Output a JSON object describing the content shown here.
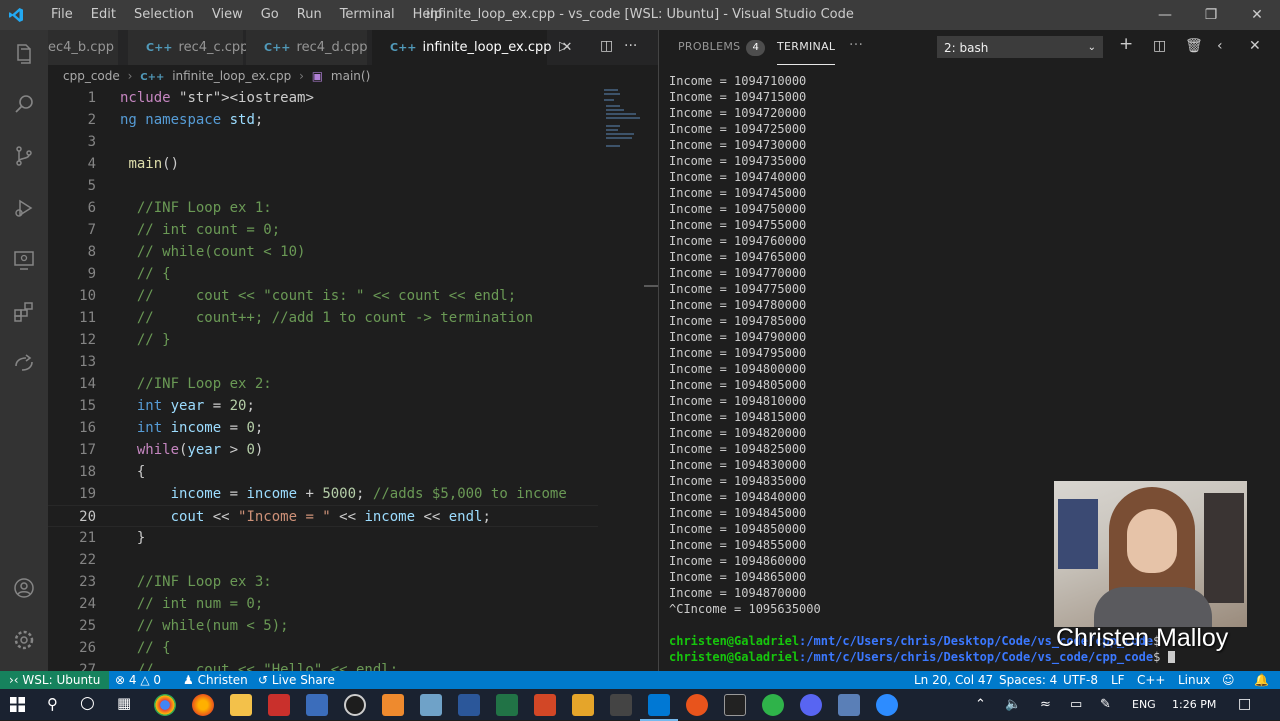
{
  "window": {
    "title": "infinite_loop_ex.cpp - vs_code [WSL: Ubuntu] - Visual Studio Code",
    "menu": [
      "File",
      "Edit",
      "Selection",
      "View",
      "Go",
      "Run",
      "Terminal",
      "Help"
    ]
  },
  "editor": {
    "tabs": [
      {
        "label": "ec4_b.cpp",
        "icon": "cpp-file-icon"
      },
      {
        "label": "rec4_c.cpp",
        "icon": "cpp-file-icon"
      },
      {
        "label": "rec4_d.cpp",
        "icon": "cpp-file-icon"
      },
      {
        "label": "infinite_loop_ex.cpp",
        "icon": "cpp-file-icon",
        "active": true
      }
    ],
    "breadcrumb": [
      "cpp_code",
      "infinite_loop_ex.cpp",
      "main()"
    ],
    "lines": [
      {
        "n": "1",
        "text": "nclude <iostream>"
      },
      {
        "n": "2",
        "text": "ng namespace std;"
      },
      {
        "n": "3",
        "text": ""
      },
      {
        "n": "4",
        "text": " main()"
      },
      {
        "n": "5",
        "text": ""
      },
      {
        "n": "6",
        "text": "  //INF Loop ex 1:"
      },
      {
        "n": "7",
        "text": "  // int count = 0;"
      },
      {
        "n": "8",
        "text": "  // while(count < 10)"
      },
      {
        "n": "9",
        "text": "  // {"
      },
      {
        "n": "10",
        "text": "  //     cout << \"count is: \" << count << endl;"
      },
      {
        "n": "11",
        "text": "  //     count++; //add 1 to count -> termination"
      },
      {
        "n": "12",
        "text": "  // }"
      },
      {
        "n": "13",
        "text": ""
      },
      {
        "n": "14",
        "text": "  //INF Loop ex 2:"
      },
      {
        "n": "15",
        "text": "  int year = 20;"
      },
      {
        "n": "16",
        "text": "  int income = 0;"
      },
      {
        "n": "17",
        "text": "  while(year > 0)"
      },
      {
        "n": "18",
        "text": "  {"
      },
      {
        "n": "19",
        "text": "      income = income + 5000; //adds $5,000 to income"
      },
      {
        "n": "20",
        "text": "      cout << \"Income = \" << income << endl;"
      },
      {
        "n": "21",
        "text": "  }"
      },
      {
        "n": "22",
        "text": ""
      },
      {
        "n": "23",
        "text": "  //INF Loop ex 3:"
      },
      {
        "n": "24",
        "text": "  // int num = 0;"
      },
      {
        "n": "25",
        "text": "  // while(num < 5);"
      },
      {
        "n": "26",
        "text": "  // {"
      },
      {
        "n": "27",
        "text": "  //     cout << \"Hello\" << endl;"
      }
    ]
  },
  "panel": {
    "problems_label": "PROBLEMS",
    "problems_count": "4",
    "terminal_label": "TERMINAL",
    "terminal_select": "2: bash",
    "output": [
      "Income = 1094710000",
      "Income = 1094715000",
      "Income = 1094720000",
      "Income = 1094725000",
      "Income = 1094730000",
      "Income = 1094735000",
      "Income = 1094740000",
      "Income = 1094745000",
      "Income = 1094750000",
      "Income = 1094755000",
      "Income = 1094760000",
      "Income = 1094765000",
      "Income = 1094770000",
      "Income = 1094775000",
      "Income = 1094780000",
      "Income = 1094785000",
      "Income = 1094790000",
      "Income = 1094795000",
      "Income = 1094800000",
      "Income = 1094805000",
      "Income = 1094810000",
      "Income = 1094815000",
      "Income = 1094820000",
      "Income = 1094825000",
      "Income = 1094830000",
      "Income = 1094835000",
      "Income = 1094840000",
      "Income = 1094845000",
      "Income = 1094850000",
      "Income = 1094855000",
      "Income = 1094860000",
      "Income = 1094865000",
      "Income = 1094870000",
      "^CIncome = 1095635000"
    ],
    "prompt_user": "christen@Galadriel",
    "prompt_path": ":/mnt/c/Users/chris/Desktop/Code/vs_code/cpp_code",
    "prompt_sign": "$"
  },
  "webcam": {
    "caption": "Christen Malloy"
  },
  "status": {
    "remote": "WSL: Ubuntu",
    "errors": "4",
    "warnings": "0",
    "user": "Christen",
    "live_share": "Live Share",
    "position": "Ln 20, Col 47",
    "spaces": "Spaces: 4",
    "encoding": "UTF-8",
    "eol": "LF",
    "language": "C++",
    "os": "Linux"
  },
  "taskbar": {
    "lang": "ENG",
    "time": "1:26 PM"
  },
  "colors": {
    "accent": "#007acc",
    "remote": "#16825d",
    "titlebar": "#3c3c3c",
    "editor_bg": "#1e1e1e"
  }
}
